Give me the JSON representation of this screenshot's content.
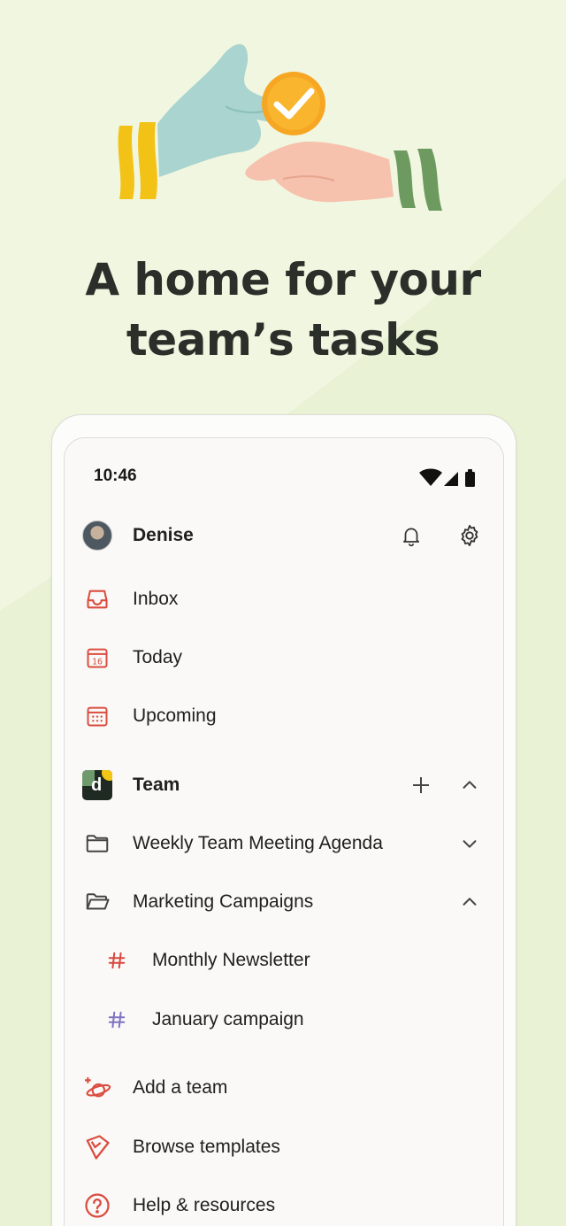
{
  "headline": {
    "line1": "A home for your",
    "line2": "team’s tasks"
  },
  "status_bar": {
    "time": "10:46"
  },
  "profile": {
    "name": "Denise"
  },
  "nav": {
    "inbox": "Inbox",
    "today": "Today",
    "today_date": "16",
    "upcoming": "Upcoming"
  },
  "team": {
    "name": "Team",
    "logo_letter": "d",
    "projects": [
      {
        "label": "Weekly Team Meeting Agenda"
      },
      {
        "label": "Marketing Campaigns"
      }
    ],
    "channels": [
      {
        "label": "Monthly Newsletter",
        "color": "#d9473f"
      },
      {
        "label": "January campaign",
        "color": "#7f73c2"
      }
    ]
  },
  "footer_links": {
    "add_team": "Add a team",
    "browse_templates": "Browse templates",
    "help": "Help & resources"
  },
  "colors": {
    "accent": "#db4c3f",
    "background": "#f1f6e0",
    "headline": "#2b2f2a"
  }
}
